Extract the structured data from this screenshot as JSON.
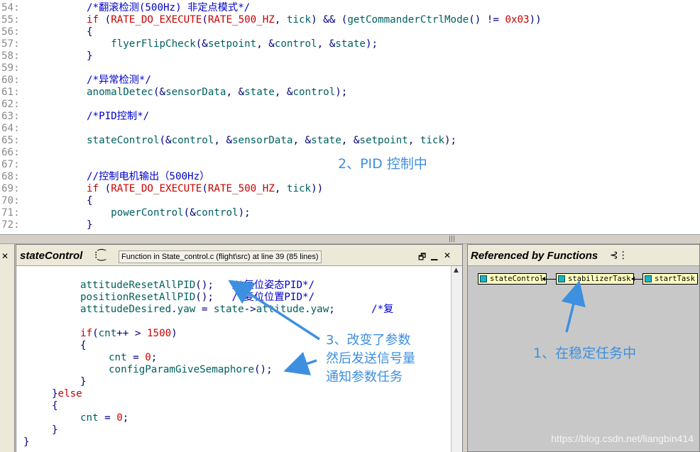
{
  "top_editor": {
    "lines": [
      {
        "n": "54:",
        "tokens": [
          [
            "c-comment",
            "/*翻滚检测(500Hz) 非定点模式*/"
          ]
        ]
      },
      {
        "n": "55:",
        "tokens": [
          [
            "c-kw",
            "if"
          ],
          [
            "c-op",
            " ("
          ],
          [
            "c-macro",
            "RATE_DO_EXECUTE"
          ],
          [
            "c-op",
            "("
          ],
          [
            "c-macro",
            "RATE_500_HZ"
          ],
          [
            "c-op",
            ", "
          ],
          [
            "c-id",
            "tick"
          ],
          [
            "c-op",
            ") && ("
          ],
          [
            "c-fn",
            "getCommanderCtrlMode"
          ],
          [
            "c-op",
            "() != "
          ],
          [
            "c-num",
            "0x03"
          ],
          [
            "c-op",
            "))"
          ]
        ]
      },
      {
        "n": "56:",
        "tokens": [
          [
            "c-op",
            "{"
          ]
        ]
      },
      {
        "n": "57:",
        "tokens": [
          [
            "c-fn",
            "    flyerFlipCheck"
          ],
          [
            "c-op",
            "(&"
          ],
          [
            "c-id",
            "setpoint"
          ],
          [
            "c-op",
            ", &"
          ],
          [
            "c-id",
            "control"
          ],
          [
            "c-op",
            ", &"
          ],
          [
            "c-id",
            "state"
          ],
          [
            "c-op",
            ");"
          ]
        ]
      },
      {
        "n": "58:",
        "tokens": [
          [
            "c-op",
            "}"
          ]
        ]
      },
      {
        "n": "59:",
        "tokens": []
      },
      {
        "n": "60:",
        "tokens": [
          [
            "c-comment",
            "/*异常检测*/"
          ]
        ]
      },
      {
        "n": "61:",
        "tokens": [
          [
            "c-fn",
            "anomalDetec"
          ],
          [
            "c-op",
            "(&"
          ],
          [
            "c-id",
            "sensorData"
          ],
          [
            "c-op",
            ", &"
          ],
          [
            "c-id",
            "state"
          ],
          [
            "c-op",
            ", &"
          ],
          [
            "c-id",
            "control"
          ],
          [
            "c-op",
            ");"
          ]
        ]
      },
      {
        "n": "62:",
        "tokens": []
      },
      {
        "n": "63:",
        "tokens": [
          [
            "c-comment",
            "/*PID控制*/"
          ]
        ]
      },
      {
        "n": "64:",
        "tokens": []
      },
      {
        "n": "65:",
        "tokens": [
          [
            "c-fn",
            "stateControl"
          ],
          [
            "c-op",
            "(&"
          ],
          [
            "c-id",
            "control"
          ],
          [
            "c-op",
            ", &"
          ],
          [
            "c-id",
            "sensorData"
          ],
          [
            "c-op",
            ", &"
          ],
          [
            "c-id",
            "state"
          ],
          [
            "c-op",
            ", &"
          ],
          [
            "c-id",
            "setpoint"
          ],
          [
            "c-op",
            ", "
          ],
          [
            "c-id",
            "tick"
          ],
          [
            "c-op",
            ");"
          ]
        ]
      },
      {
        "n": "66:",
        "tokens": []
      },
      {
        "n": "67:",
        "tokens": []
      },
      {
        "n": "68:",
        "tokens": [
          [
            "c-comment",
            "//控制电机输出（500Hz）"
          ]
        ]
      },
      {
        "n": "69:",
        "tokens": [
          [
            "c-kw",
            "if"
          ],
          [
            "c-op",
            " ("
          ],
          [
            "c-macro",
            "RATE_DO_EXECUTE"
          ],
          [
            "c-op",
            "("
          ],
          [
            "c-macro",
            "RATE_500_HZ"
          ],
          [
            "c-op",
            ", "
          ],
          [
            "c-id",
            "tick"
          ],
          [
            "c-op",
            "))"
          ]
        ]
      },
      {
        "n": "70:",
        "tokens": [
          [
            "c-op",
            "{"
          ]
        ]
      },
      {
        "n": "71:",
        "tokens": [
          [
            "c-fn",
            "    powerControl"
          ],
          [
            "c-op",
            "(&"
          ],
          [
            "c-id",
            "control"
          ],
          [
            "c-op",
            ");"
          ]
        ]
      },
      {
        "n": "72:",
        "tokens": [
          [
            "c-op",
            "}"
          ]
        ]
      }
    ],
    "annotation": "2、PID 控制中"
  },
  "context_panel": {
    "title": "stateControl",
    "tree_icon": "tree-icon",
    "info": "Function in State_control.c (flight\\src) at line 39 (85 lines)",
    "buttons": {
      "restore": "🗗",
      "minimize": "▁",
      "close": "✕"
    },
    "lines": [
      {
        "indent": 0,
        "tokens": []
      },
      {
        "indent": 80,
        "tokens": [
          [
            "b-fn",
            "attitudeResetAllPID"
          ],
          [
            "b-op",
            "();   "
          ],
          [
            "b-comment",
            "/*复位姿态PID*/"
          ]
        ]
      },
      {
        "indent": 80,
        "tokens": [
          [
            "b-fn",
            "positionResetAllPID"
          ],
          [
            "b-op",
            "();   "
          ],
          [
            "b-comment",
            "/*复位位置PID*/"
          ]
        ]
      },
      {
        "indent": 80,
        "tokens": [
          [
            "b-fn",
            "attitudeDesired"
          ],
          [
            "b-op",
            "."
          ],
          [
            "b-fn",
            "yaw"
          ],
          [
            "b-op",
            " = "
          ],
          [
            "b-fn",
            "state"
          ],
          [
            "b-op",
            "->"
          ],
          [
            "b-fn",
            "attitude"
          ],
          [
            "b-op",
            "."
          ],
          [
            "b-fn",
            "yaw"
          ],
          [
            "b-op",
            ";      "
          ],
          [
            "b-comment",
            "/*复"
          ]
        ]
      },
      {
        "indent": 0,
        "tokens": []
      },
      {
        "indent": 80,
        "tokens": [
          [
            "b-kw",
            "if"
          ],
          [
            "b-op",
            "("
          ],
          [
            "b-fn",
            "cnt"
          ],
          [
            "b-op",
            "++ > "
          ],
          [
            "b-num",
            "1500"
          ],
          [
            "b-op",
            ")"
          ]
        ]
      },
      {
        "indent": 80,
        "tokens": [
          [
            "b-op",
            "{"
          ]
        ]
      },
      {
        "indent": 120,
        "tokens": [
          [
            "b-fn",
            "cnt"
          ],
          [
            "b-op",
            " = "
          ],
          [
            "b-num",
            "0"
          ],
          [
            "b-op",
            ";"
          ]
        ]
      },
      {
        "indent": 120,
        "tokens": [
          [
            "b-fn",
            "configParamGiveSemaphore"
          ],
          [
            "b-op",
            "();"
          ]
        ]
      },
      {
        "indent": 80,
        "tokens": [
          [
            "b-op",
            "}"
          ]
        ]
      },
      {
        "indent": 40,
        "tokens": [
          [
            "b-op",
            "}"
          ],
          [
            "b-kw",
            "else"
          ]
        ]
      },
      {
        "indent": 40,
        "tokens": [
          [
            "b-op",
            "{"
          ]
        ]
      },
      {
        "indent": 80,
        "tokens": [
          [
            "b-fn",
            "cnt"
          ],
          [
            "b-op",
            " = "
          ],
          [
            "b-num",
            "0"
          ],
          [
            "b-op",
            ";"
          ]
        ]
      },
      {
        "indent": 40,
        "tokens": [
          [
            "b-op",
            "}"
          ]
        ]
      },
      {
        "indent": 0,
        "tokens": [
          [
            "b-op",
            "}"
          ]
        ]
      }
    ],
    "annotation": [
      "3、改变了参数",
      "然后发送信号量",
      "通知参数任务"
    ]
  },
  "ref_panel": {
    "title": "Referenced by Functions",
    "nodes": [
      {
        "id": "stateControl",
        "label": "stateControl"
      },
      {
        "id": "stabilizerTask",
        "label": "stabilizerTask"
      },
      {
        "id": "startTask",
        "label": "startTask"
      }
    ],
    "annotation": "1、在稳定任务中"
  },
  "annotation_color": "#3d8fe0",
  "watermark": "https://blog.csdn.net/liangbin414",
  "splitter_grip": "|||"
}
